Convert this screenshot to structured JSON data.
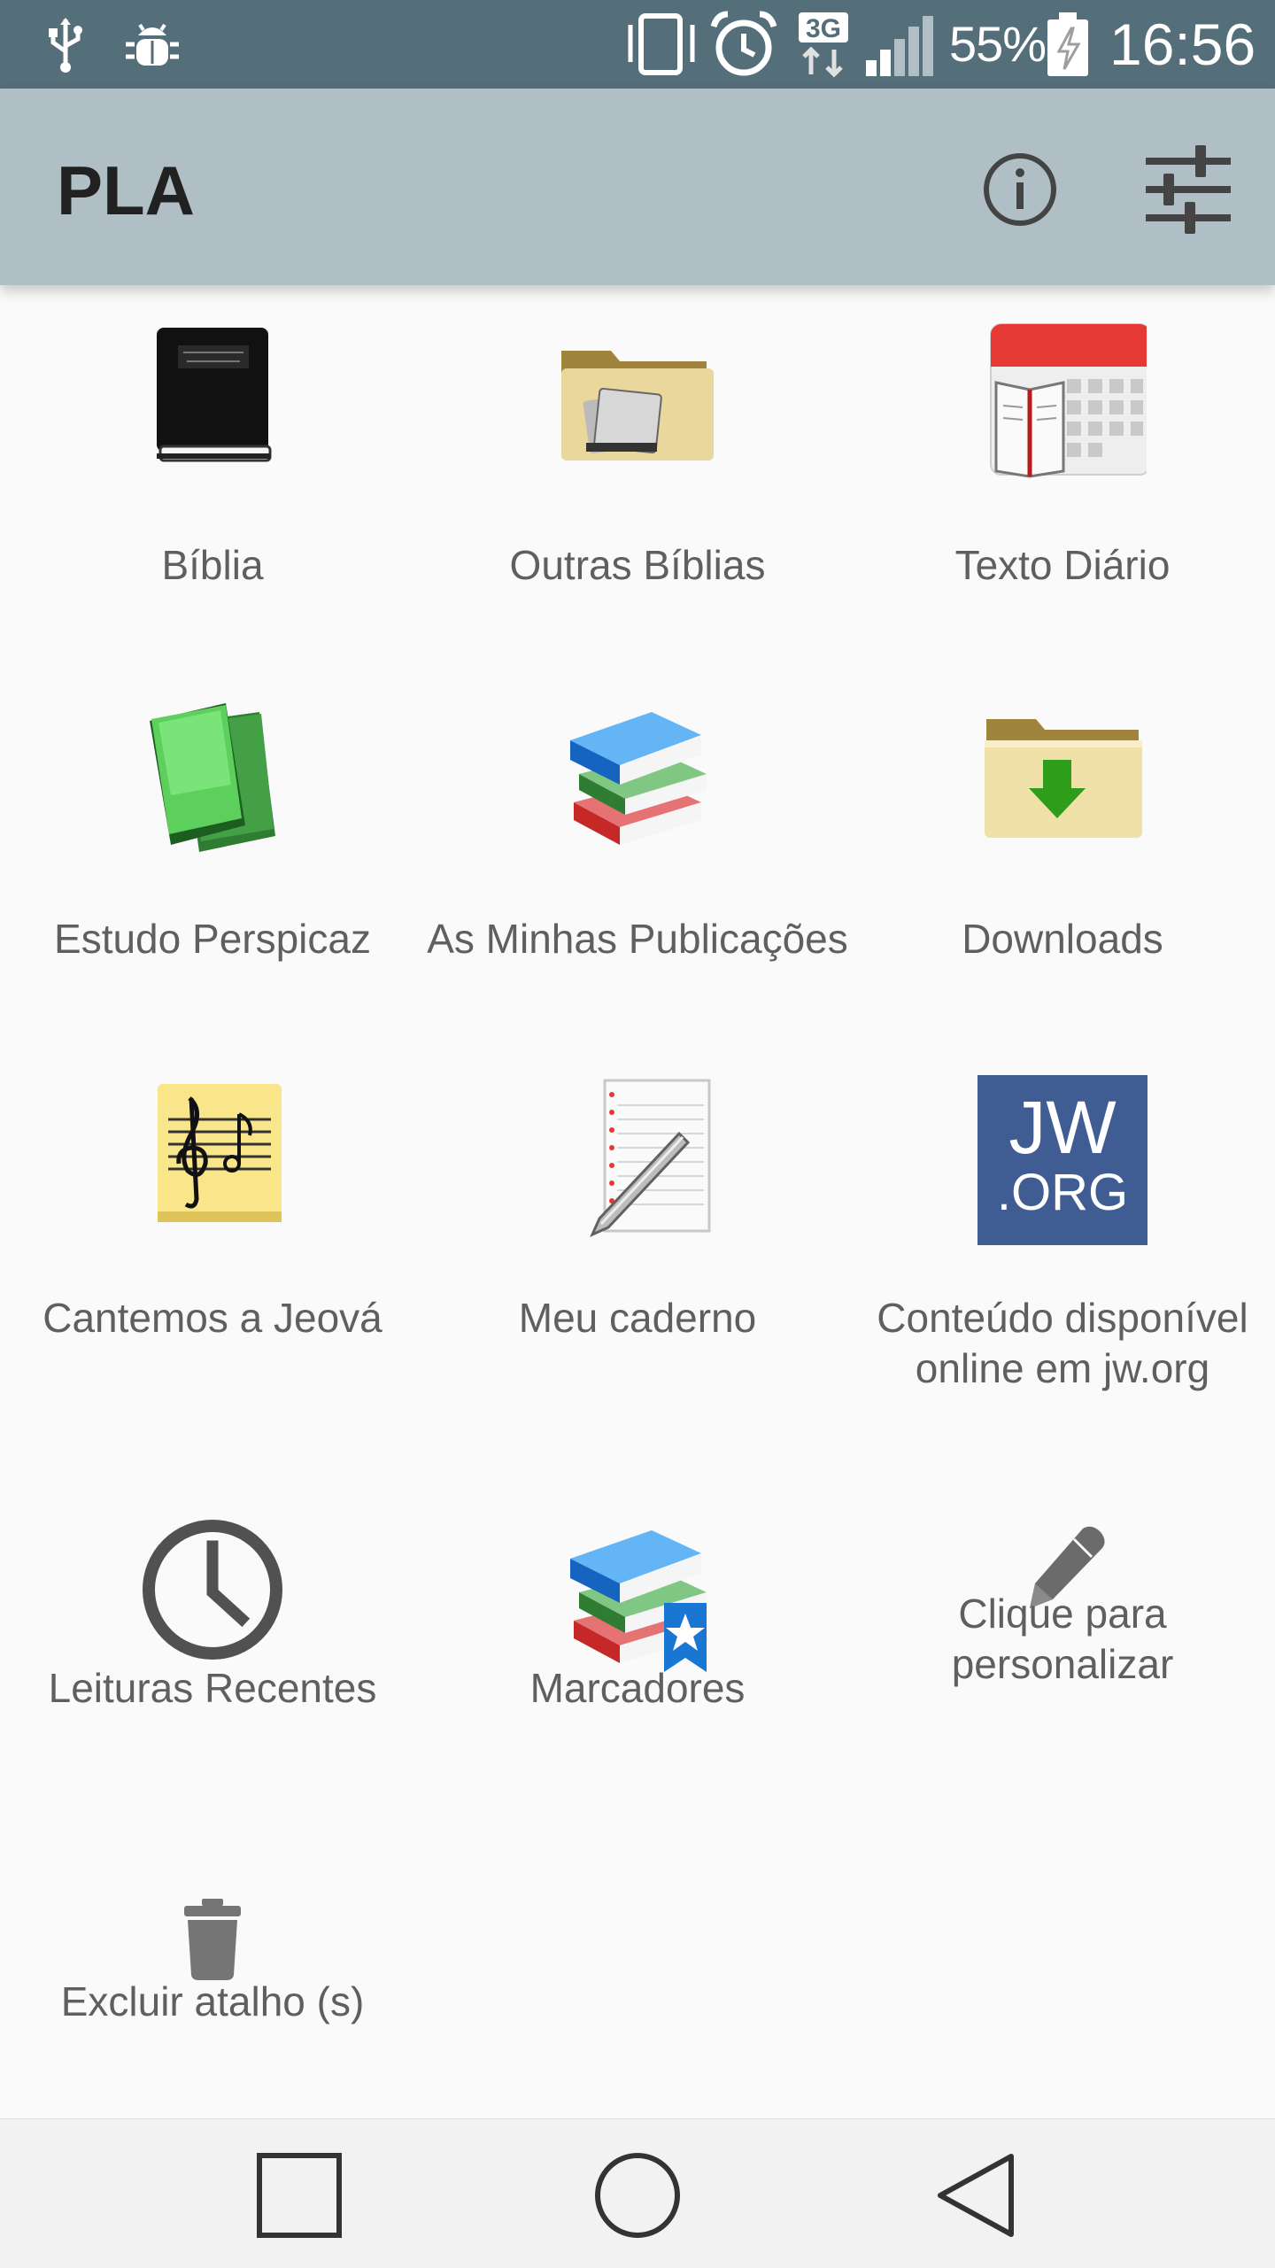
{
  "status_bar": {
    "battery_percent": "55%",
    "time": "16:56",
    "network_type": "3G",
    "icons": [
      "usb-icon",
      "debug-icon",
      "vibrate-icon",
      "alarm-icon",
      "network-3g-icon",
      "signal-icon",
      "battery-charging-icon"
    ]
  },
  "app_bar": {
    "title": "PLA",
    "info_icon": "info-icon",
    "settings_icon": "sliders-icon"
  },
  "grid": {
    "items": [
      {
        "label": "Bíblia",
        "icon": "bible-book-icon"
      },
      {
        "label": "Outras Bíblias",
        "icon": "folder-bibles-icon"
      },
      {
        "label": "Texto Diário",
        "icon": "calendar-book-icon"
      },
      {
        "label": "Estudo Perspicaz",
        "icon": "green-books-icon"
      },
      {
        "label": "As Minhas Publicações",
        "icon": "book-stack-icon"
      },
      {
        "label": "Downloads",
        "icon": "download-folder-icon"
      },
      {
        "label": "Cantemos a Jeová",
        "icon": "music-book-icon"
      },
      {
        "label": "Meu caderno",
        "icon": "notebook-pen-icon"
      },
      {
        "label": "Conteúdo disponível online em jw.org",
        "icon": "jw-org-logo"
      },
      {
        "label": "Leituras Recentes",
        "icon": "clock-icon"
      },
      {
        "label": "Marcadores",
        "icon": "bookmarked-books-icon"
      },
      {
        "label": "Clique para personalizar",
        "icon": "pencil-icon"
      },
      {
        "label": "Excluir atalho (s)",
        "icon": "trash-icon"
      }
    ],
    "jw_logo": {
      "line1": "JW",
      "line2": ".ORG"
    }
  },
  "nav_bar": {
    "icons": [
      "recents-square-icon",
      "home-circle-icon",
      "back-triangle-icon"
    ]
  },
  "colors": {
    "status_bar": "#546e7a",
    "app_bar": "#b0bec5",
    "background": "#fafafa",
    "label_text": "#5f5f5f",
    "jw_blue": "#3f5d93"
  }
}
